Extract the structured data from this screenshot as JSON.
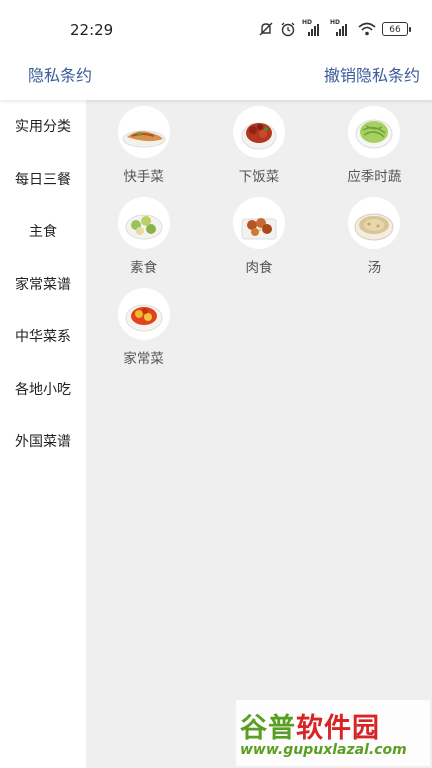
{
  "status_bar": {
    "time": "22:29",
    "icons": [
      "mute-icon",
      "alarm-icon",
      "signal-hd-icon",
      "signal-hd-icon",
      "wifi-icon",
      "battery-icon"
    ],
    "signal_tag": "HD",
    "battery": "66"
  },
  "header": {
    "left_link": "隐私条约",
    "right_link": "撤销隐私条约",
    "link_color": "#3b5b9a"
  },
  "sidebar": {
    "items": [
      {
        "label": "实用分类",
        "active": false
      },
      {
        "label": "每日三餐",
        "active": true
      },
      {
        "label": "主食",
        "active": false
      },
      {
        "label": "家常菜谱",
        "active": false
      },
      {
        "label": "中华菜系",
        "active": false
      },
      {
        "label": "各地小吃",
        "active": false
      },
      {
        "label": "外国菜谱",
        "active": false
      }
    ]
  },
  "categories": [
    {
      "label": "快手菜",
      "icon": "quick-dish-icon"
    },
    {
      "label": "下饭菜",
      "icon": "rice-dish-icon"
    },
    {
      "label": "应季时蔬",
      "icon": "seasonal-veg-icon"
    },
    {
      "label": "素食",
      "icon": "vegetarian-icon"
    },
    {
      "label": "肉食",
      "icon": "meat-dish-icon"
    },
    {
      "label": "汤",
      "icon": "soup-icon"
    },
    {
      "label": "家常菜",
      "icon": "home-dish-icon"
    }
  ],
  "watermark": {
    "title_part1": "谷普",
    "title_part2": "软件园",
    "url": "www.gupuxlazal.com"
  }
}
